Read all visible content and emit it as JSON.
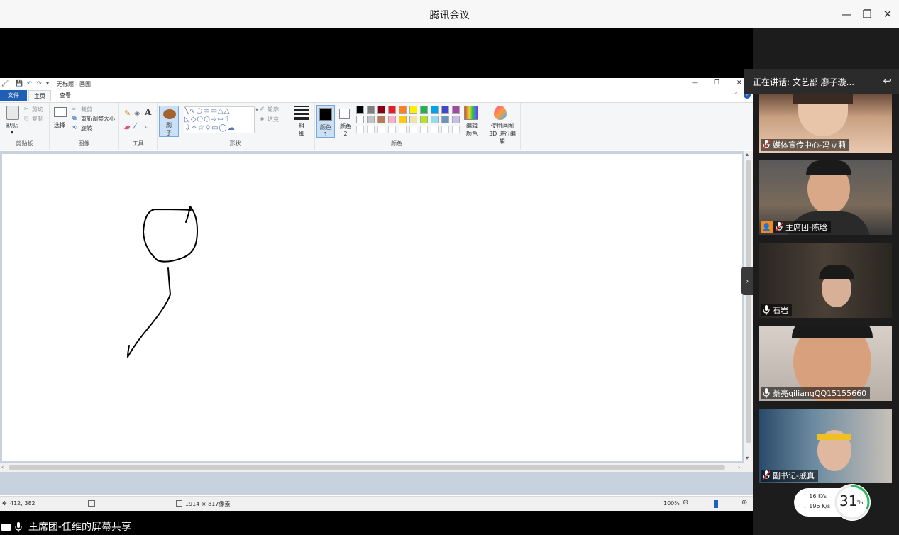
{
  "window": {
    "title": "腾讯会议",
    "minimize": "—",
    "restore": "❐",
    "close": "✕"
  },
  "paint": {
    "doc_title": "无标题 - 画图",
    "tabs": {
      "file": "文件",
      "home": "主页",
      "view": "查看"
    },
    "clipboard": {
      "paste": "粘贴",
      "cut": "剪切",
      "copy": "复制",
      "label": "剪贴板"
    },
    "image": {
      "select": "选择",
      "crop": "裁剪",
      "resize": "重新调整大小",
      "rotate": "旋转",
      "label": "图像"
    },
    "tools": {
      "label": "工具"
    },
    "brush": {
      "label": "刷子"
    },
    "shapes": {
      "outline": "轮廓",
      "fill": "填充",
      "label": "形状"
    },
    "size": {
      "label": "粗细"
    },
    "colors": {
      "color1": "颜色 1",
      "color2": "颜色 2",
      "edit": "编辑颜色",
      "paint3d": "使用画图 3D 进行编辑",
      "label": "颜色",
      "palette_row1": [
        "#000000",
        "#7f7f7f",
        "#880015",
        "#ed1c24",
        "#ff7f27",
        "#fff200",
        "#22b14c",
        "#00a2e8",
        "#3f48cc",
        "#a349a4"
      ],
      "palette_row2": [
        "#ffffff",
        "#c3c3c3",
        "#b97a57",
        "#ffaec9",
        "#ffc90e",
        "#efe4b0",
        "#b5e61d",
        "#99d9ea",
        "#7092be",
        "#c8bfe7"
      ]
    },
    "status": {
      "cursor_pos": "412, 382",
      "canvas_size": "1914 × 817像素",
      "zoom": "100%"
    }
  },
  "share_label": "主席团-任维的屏幕共享",
  "panel": {
    "speaking": "正在讲话: 文艺部 廖子璇...",
    "participants": [
      {
        "name": "媒体宣传中心-冯立莉",
        "mic": "muted"
      },
      {
        "name": "主席团-陈晗",
        "mic": "muted",
        "host": true
      },
      {
        "name": "石岩",
        "mic": "on"
      },
      {
        "name": "綦亮qiliangQQ15155660",
        "mic": "on"
      },
      {
        "name": "副书记-戚真",
        "mic": "muted"
      }
    ]
  },
  "network": {
    "up": "16 K/s",
    "down": "196 K/s",
    "cpu": "31",
    "cpu_unit": "%"
  },
  "colors": {
    "accent_blue": "#1f5fb5",
    "panel_bg": "#1c1c1c",
    "cpu_ring": "#2dbb5d"
  }
}
